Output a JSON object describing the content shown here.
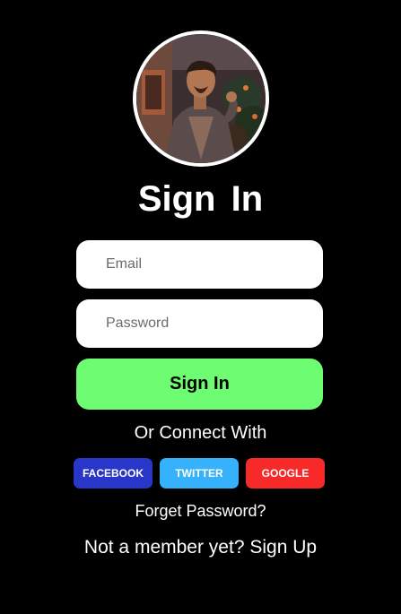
{
  "avatar": {
    "icon": "profile-photo"
  },
  "title": "Sign In",
  "form": {
    "email_placeholder": "Email",
    "password_placeholder": "Password",
    "submit_label": "Sign In",
    "submit_color": "#6dfc72"
  },
  "connect": {
    "label": "Or Connect With",
    "buttons": [
      {
        "label": "FACEBOOK",
        "color": "#2836c9"
      },
      {
        "label": "TWITTER",
        "color": "#35b2fb"
      },
      {
        "label": "GOOGLE",
        "color": "#f82929"
      }
    ]
  },
  "forget_password": "Forget Password?",
  "member": {
    "prefix": "Not a member yet?",
    "link": "Sign Up"
  }
}
